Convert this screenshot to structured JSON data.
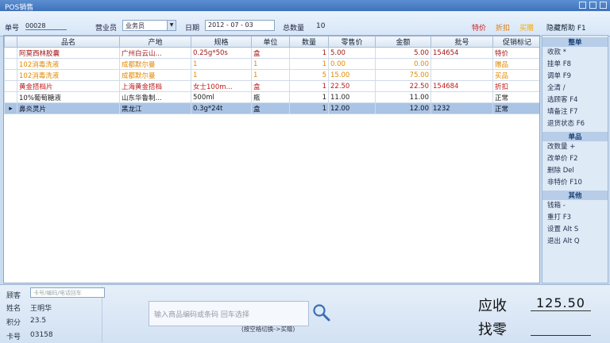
{
  "window": {
    "title": "POS销售"
  },
  "toolbar": {
    "order_label": "单号",
    "order_value": "00028",
    "clerk_label": "营业员",
    "clerk_value": "业务员",
    "date_label": "日期",
    "date_value": "2012 - 07 - 03",
    "total_qty_label": "总数量",
    "total_qty_value": "10",
    "special_label": "特价",
    "discount_label": "折扣",
    "buy_label": "买赠",
    "hide_help_label": "隐藏帮助 F1"
  },
  "table": {
    "headers": [
      "品名",
      "产地",
      "规格",
      "单位",
      "数量",
      "零售价",
      "金额",
      "批号",
      "促销标记"
    ],
    "rows": [
      {
        "name": "阿莫西林胶囊",
        "origin": "广州白云山...",
        "spec": "0.25g*50s",
        "unit": "盒",
        "qty": "1",
        "price": "5.00",
        "amount": "5.00",
        "batch": "154654",
        "promo": "特价",
        "color": "#a01818"
      },
      {
        "name": "102消毒洗液",
        "origin": "成都默尔曼",
        "spec": "1",
        "unit": "1",
        "qty": "1",
        "price": "0.00",
        "amount": "0.00",
        "batch": "",
        "promo": "赠品",
        "color": "#e08a00"
      },
      {
        "name": "102消毒洗液",
        "origin": "成都默尔曼",
        "spec": "1",
        "unit": "1",
        "qty": "5",
        "price": "15.00",
        "amount": "75.00",
        "batch": "",
        "promo": "买品",
        "color": "#e08a00"
      },
      {
        "name": "黄金搭档片",
        "origin": "上海黄金搭档",
        "spec": "女士100m...",
        "unit": "盒",
        "qty": "1",
        "price": "22.50",
        "amount": "22.50",
        "batch": "154684",
        "promo": "折扣",
        "color": "#c01a1a"
      },
      {
        "name": "10%葡萄糖液",
        "origin": "山东华鲁制...",
        "spec": "500ml",
        "unit": "瓶",
        "qty": "1",
        "price": "11.00",
        "amount": "11.00",
        "batch": "",
        "promo": "正常",
        "color": "#222222"
      },
      {
        "name": "鼻炎灵片",
        "origin": "黑龙江",
        "spec": "0.3g*24t",
        "unit": "盒",
        "qty": "1",
        "price": "12.00",
        "amount": "12.00",
        "batch": "1232",
        "promo": "正常",
        "color": "#222222"
      }
    ],
    "selected_row_index": 5,
    "row_indicator": "▸"
  },
  "sidebar": {
    "sections": [
      {
        "title": "整单",
        "items": [
          "收款 *",
          "挂单 F8",
          "调单 F9",
          "全清 /",
          "选顾客 F4",
          "填备注 F7",
          "退货状态 F6"
        ]
      },
      {
        "title": "单品",
        "items": [
          "改数量 +",
          "改单价 F2",
          "删除 Del",
          "非特价 F10"
        ]
      },
      {
        "title": "其他",
        "items": [
          "钱箱 -",
          "重打 F3",
          "设置 Alt S",
          "退出 Alt Q"
        ]
      }
    ]
  },
  "customer": {
    "label": "顾客",
    "input_placeholder": "卡号/编码/电话回车",
    "name_label": "姓名",
    "name_value": "王明华",
    "points_label": "积分",
    "points_value": "23.5",
    "card_label": "卡号",
    "card_value": "03158"
  },
  "scan": {
    "placeholder": "输入商品编码或条码 回车选择",
    "hint": "(按空格切换->买赠)"
  },
  "totals": {
    "receivable_label": "应收",
    "receivable_value": "125.50",
    "change_label": "找零",
    "change_value": ""
  },
  "colors": {
    "special": "#cc1a1a",
    "discount": "#e07800",
    "buy": "#f0a800",
    "selected_row": "#a9c4e4"
  }
}
